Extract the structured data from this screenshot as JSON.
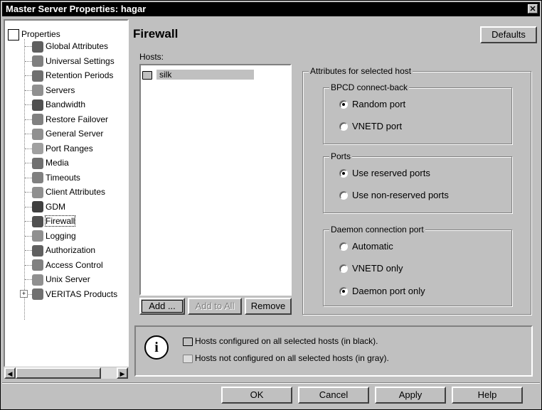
{
  "window": {
    "title": "Master Server Properties: hagar",
    "close_glyph": "✕"
  },
  "tree": {
    "root": "Properties",
    "items": [
      "Global Attributes",
      "Universal Settings",
      "Retention Periods",
      "Servers",
      "Bandwidth",
      "Restore Failover",
      "General Server",
      "Port Ranges",
      "Media",
      "Timeouts",
      "Client Attributes",
      "GDM",
      "Firewall",
      "Logging",
      "Authorization",
      "Access Control",
      "Unix Server",
      "VERITAS Products"
    ],
    "selected": "Firewall",
    "expander": "+"
  },
  "panel": {
    "title": "Firewall",
    "defaults_button": "Defaults",
    "hosts_label": "Hosts:",
    "hosts": [
      "silk"
    ],
    "add_button": "Add ...",
    "add_to_all_button": "Add to All",
    "remove_button": "Remove",
    "attributes_group": "Attributes for selected host",
    "bpcd_group": "BPCD connect-back",
    "bpcd_options": {
      "random": "Random port",
      "vnetd": "VNETD port"
    },
    "ports_group": "Ports",
    "ports_options": {
      "reserved": "Use reserved ports",
      "nonreserved": "Use non-reserved ports"
    },
    "daemon_group": "Daemon connection port",
    "daemon_options": {
      "automatic": "Automatic",
      "vnetd_only": "VNETD only",
      "daemon_only": "Daemon port only"
    },
    "info_black": "Hosts configured on all selected hosts (in black).",
    "info_gray": "Hosts not configured on all selected hosts (in gray)."
  },
  "footer": {
    "ok": "OK",
    "cancel": "Cancel",
    "apply": "Apply",
    "help": "Help"
  },
  "colors": {
    "title_bg": "#000000",
    "face": "#c0c0c0",
    "highlight": "#c0c0c0"
  }
}
